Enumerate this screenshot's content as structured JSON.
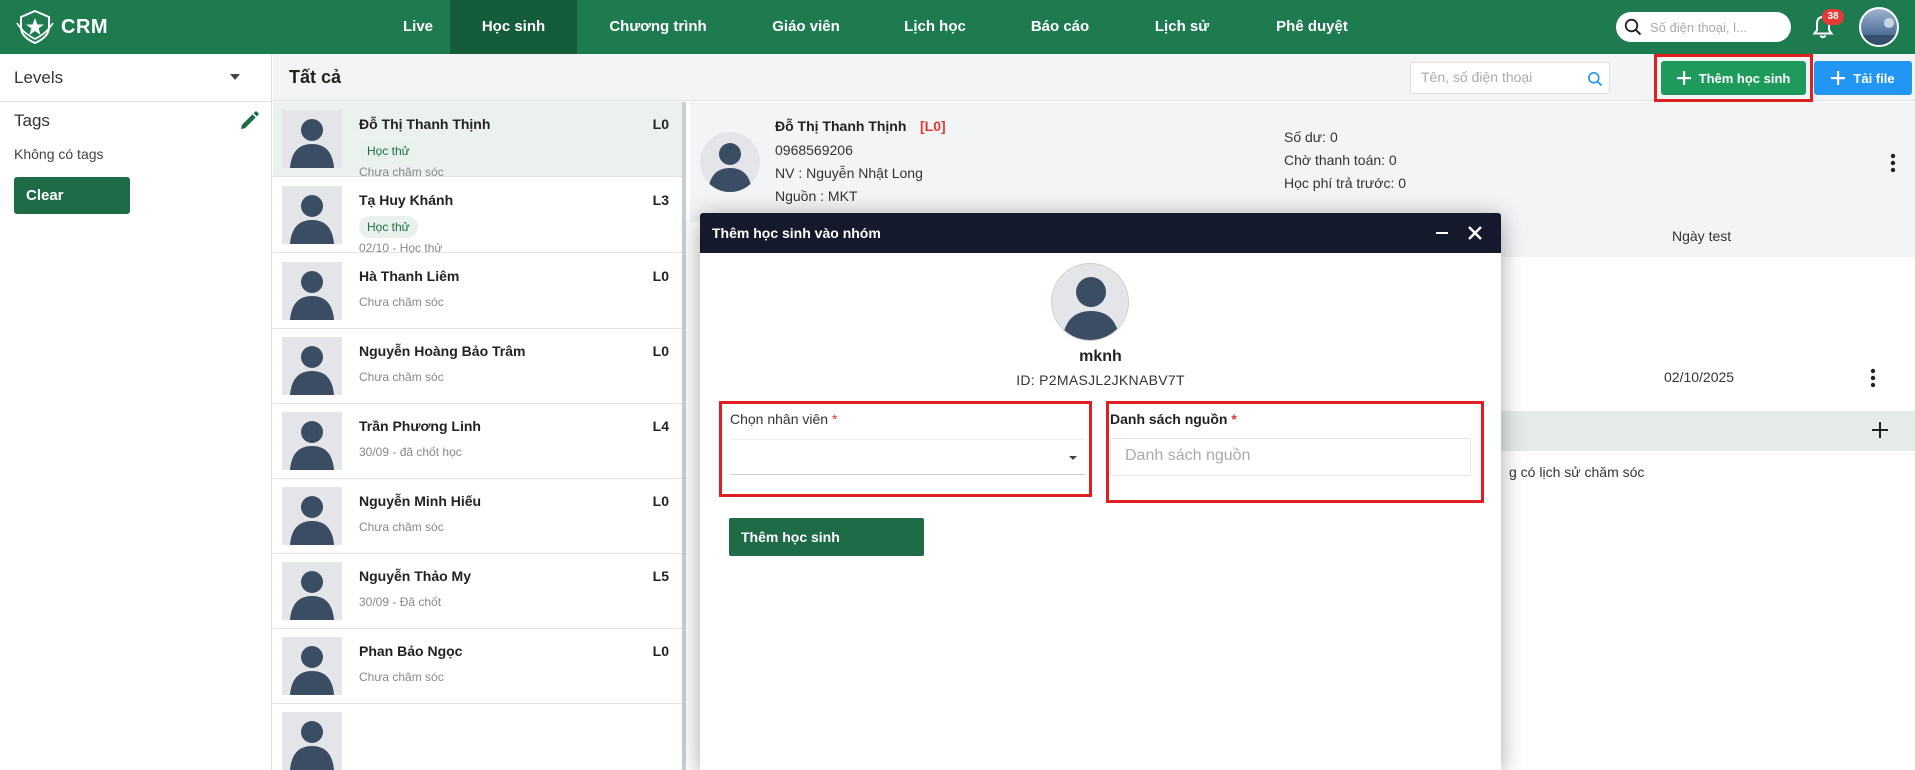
{
  "brand": {
    "name": "CRM"
  },
  "nav": [
    {
      "label": "Live"
    },
    {
      "label": "Học sinh",
      "active": true
    },
    {
      "label": "Chương trình"
    },
    {
      "label": "Giáo viên"
    },
    {
      "label": "Lịch học"
    },
    {
      "label": "Báo cáo"
    },
    {
      "label": "Lịch sử"
    },
    {
      "label": "Phê duyệt"
    }
  ],
  "topbar": {
    "search_placeholder": "Số điện thoại, l...",
    "notification_count": "38"
  },
  "filters": {
    "levels_label": "Levels",
    "tags_label": "Tags",
    "no_tags": "Không có tags",
    "clear_label": "Clear"
  },
  "header": {
    "title": "Tất cả",
    "search_placeholder": "Tên, số điện thoại",
    "add_student_label": "Thêm học sinh",
    "upload_label": "Tải file"
  },
  "students": [
    {
      "name": "Đỗ Thị Thanh Thịnh",
      "level": "L0",
      "tag": "Học thử",
      "sub": "Chưa chăm sóc",
      "selected": true
    },
    {
      "name": "Tạ Huy Khánh",
      "level": "L3",
      "tag": "Học thử",
      "sub": "02/10 - Học thử"
    },
    {
      "name": "Hà Thanh Liêm",
      "level": "L0",
      "tag": "",
      "sub": "Chưa chăm sóc"
    },
    {
      "name": "Nguyễn Hoàng Bảo Trâm",
      "level": "L0",
      "tag": "",
      "sub": "Chưa chăm sóc"
    },
    {
      "name": "Trần Phương Linh",
      "level": "L4",
      "tag": "",
      "sub": "30/09 - đã chốt học"
    },
    {
      "name": "Nguyễn Minh Hiếu",
      "level": "L0",
      "tag": "",
      "sub": "Chưa chăm sóc"
    },
    {
      "name": "Nguyễn Thảo My",
      "level": "L5",
      "tag": "",
      "sub": "30/09 - Đã chốt"
    },
    {
      "name": "Phan Bảo Ngọc",
      "level": "L0",
      "tag": "",
      "sub": "Chưa chăm sóc"
    }
  ],
  "detail": {
    "name": "Đỗ Thị Thanh Thịnh",
    "level": "[L0]",
    "phone": "0968569206",
    "staff": "NV : Nguyễn Nhật Long",
    "source": "Nguồn : MKT",
    "balance": "Số dư: 0",
    "pending": "Chờ thanh toán: 0",
    "prepaid": "Học phí trả trước: 0",
    "test_date_header": "Ngày test",
    "test_date": "02/10/2025",
    "care_empty": "g có lịch sử chăm sóc"
  },
  "modal": {
    "title": "Thêm học sinh vào nhóm",
    "username": "mknh",
    "id_text": "ID:  P2MASJL2JKNABV7T",
    "staff_label": "Chọn nhân viên",
    "source_label": "Danh sách nguồn",
    "required_mark": "*",
    "source_placeholder": "Danh sách nguồn",
    "submit_label": "Thêm học sinh"
  },
  "colors": {
    "brand_green": "#1e7b4f",
    "dark_green": "#1e6b47",
    "accent_blue": "#2196f3",
    "alert_red": "#e53935",
    "modal_header": "#141a2b"
  }
}
